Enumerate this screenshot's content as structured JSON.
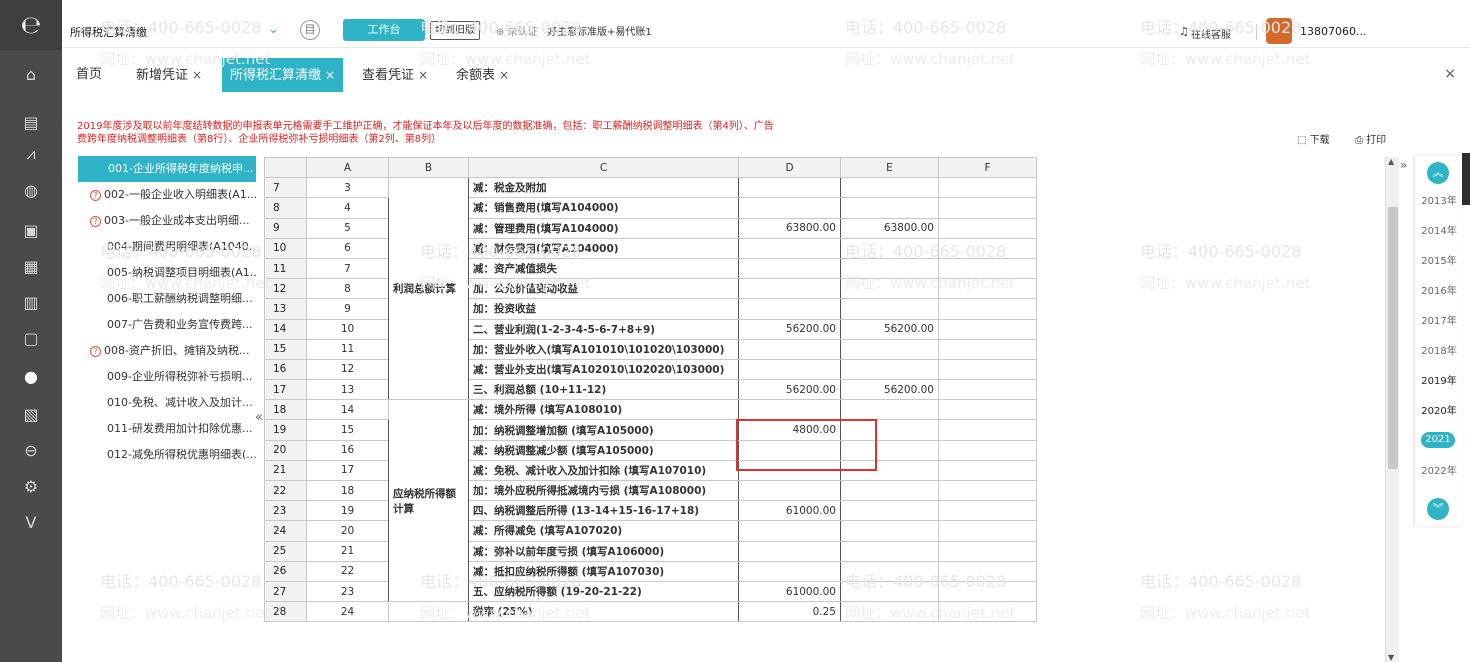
{
  "app": {
    "book_name": "所得税汇算清缴",
    "workspace_label": "工作台",
    "switch_old_label": "切到旧版",
    "cert_status": "未认证",
    "edition": "好生意标准版+易代账1",
    "online_service": "在线客服",
    "username": "13807060..."
  },
  "tabs": [
    {
      "label": "首页",
      "closable": false
    },
    {
      "label": "新增凭证",
      "closable": true
    },
    {
      "label": "所得税汇算清缴",
      "closable": true,
      "active": true
    },
    {
      "label": "查看凭证",
      "closable": true
    },
    {
      "label": "余额表",
      "closable": true
    }
  ],
  "tab_close_label": "×",
  "notice": "2019年度涉及取以前年度结转数据的申报表单元格需要手工维护正确，才能保证本年及以后年度的数据准确，包括：职工薪酬纳税调整明细表（第4列）、广告费跨年度纳税调整明细表（第8行）、企业所得税弥补亏损明细表（第2列、第8列）",
  "toolbar": {
    "download": "下载",
    "print": "打印"
  },
  "forms": [
    {
      "label": "001-企业所得税年度纳税申...",
      "selected": true,
      "warn": false
    },
    {
      "label": "002-一般企业收入明细表(A1...",
      "warn": true
    },
    {
      "label": "003-一般企业成本支出明细...",
      "warn": true
    },
    {
      "label": "004-期间费用明细表(A1040...",
      "warn": false
    },
    {
      "label": "005-纳税调整项目明细表(A1...",
      "warn": false
    },
    {
      "label": "006-职工薪酬纳税调整明细...",
      "warn": false
    },
    {
      "label": "007-广告费和业务宣传费跨...",
      "warn": false
    },
    {
      "label": "008-资产折旧、摊销及纳税...",
      "warn": true
    },
    {
      "label": "009-企业所得税弥补亏损明...",
      "warn": false
    },
    {
      "label": "010-免税、减计收入及加计...",
      "warn": false
    },
    {
      "label": "011-研发费用加计扣除优惠...",
      "warn": false
    },
    {
      "label": "012-减免所得税优惠明细表(...",
      "warn": false
    }
  ],
  "sheet": {
    "columns": [
      "",
      "A",
      "B",
      "C",
      "D",
      "E",
      "F"
    ],
    "groups": {
      "profit": "利润总额计算",
      "taxable": "应纳税所得额计算"
    },
    "rows": [
      {
        "rn": "7",
        "a": "3",
        "c": "减：税金及附加",
        "d": "",
        "e": ""
      },
      {
        "rn": "8",
        "a": "4",
        "c": "减：销售费用(填写A104000)",
        "d": "",
        "e": ""
      },
      {
        "rn": "9",
        "a": "5",
        "c": "减：管理费用(填写A104000)",
        "d": "63800.00",
        "e": "63800.00"
      },
      {
        "rn": "10",
        "a": "6",
        "c": "减：财务费用(填写A104000)",
        "d": "",
        "e": ""
      },
      {
        "rn": "11",
        "a": "7",
        "c": "减：资产减值损失",
        "d": "",
        "e": ""
      },
      {
        "rn": "12",
        "a": "8",
        "c": "加：公允价值变动收益",
        "d": "",
        "e": ""
      },
      {
        "rn": "13",
        "a": "9",
        "c": "加：投资收益",
        "d": "",
        "e": ""
      },
      {
        "rn": "14",
        "a": "10",
        "c": "二、营业利润(1-2-3-4-5-6-7+8+9)",
        "d": "56200.00",
        "e": "56200.00"
      },
      {
        "rn": "15",
        "a": "11",
        "c": "加：营业外收入(填写A101010\\101020\\103000)",
        "d": "",
        "e": ""
      },
      {
        "rn": "16",
        "a": "12",
        "c": "减：营业外支出(填写A102010\\102020\\103000)",
        "d": "",
        "e": ""
      },
      {
        "rn": "17",
        "a": "13",
        "c": "三、利润总额 (10+11-12)",
        "d": "56200.00",
        "e": "56200.00"
      },
      {
        "rn": "18",
        "a": "14",
        "c": "减：境外所得 (填写A108010)",
        "d": "",
        "e": ""
      },
      {
        "rn": "19",
        "a": "15",
        "c": "加：纳税调整增加额 (填写A105000)",
        "d": "4800.00",
        "e": ""
      },
      {
        "rn": "20",
        "a": "16",
        "c": "减：纳税调整减少额 (填写A105000)",
        "d": "",
        "e": ""
      },
      {
        "rn": "21",
        "a": "17",
        "c": "减：免税、减计收入及加计扣除 (填写A107010)",
        "d": "",
        "e": ""
      },
      {
        "rn": "22",
        "a": "18",
        "c": "加：境外应税所得抵减境内亏损 (填写A108000)",
        "d": "",
        "e": ""
      },
      {
        "rn": "23",
        "a": "19",
        "c": "四、纳税调整后所得 (13-14+15-16-17+18)",
        "d": "61000.00",
        "e": ""
      },
      {
        "rn": "24",
        "a": "20",
        "c": "减：所得减免 (填写A107020)",
        "d": "",
        "e": ""
      },
      {
        "rn": "25",
        "a": "21",
        "c": "减：弥补以前年度亏损 (填写A106000)",
        "d": "",
        "e": ""
      },
      {
        "rn": "26",
        "a": "22",
        "c": "减：抵扣应纳税所得额 (填写A107030)",
        "d": "",
        "e": ""
      },
      {
        "rn": "27",
        "a": "23",
        "c": "五、应纳税所得额 (19-20-21-22)",
        "d": "61000.00",
        "e": ""
      },
      {
        "rn": "28",
        "a": "24",
        "c": "税率 (25%)",
        "d": "0.25",
        "e": ""
      }
    ]
  },
  "years": [
    "2013年",
    "2014年",
    "2015年",
    "2016年",
    "2017年",
    "2018年",
    "2019年",
    "2020年",
    "2021年",
    "2022年"
  ],
  "selected_year": "2021年",
  "watermark": {
    "phone": "电话：400-665-0028",
    "url": "网址：www.chanjet.net"
  },
  "colors": {
    "accent": "#2eb3c7",
    "rail": "#4a4a4a",
    "warn": "#e03030"
  }
}
